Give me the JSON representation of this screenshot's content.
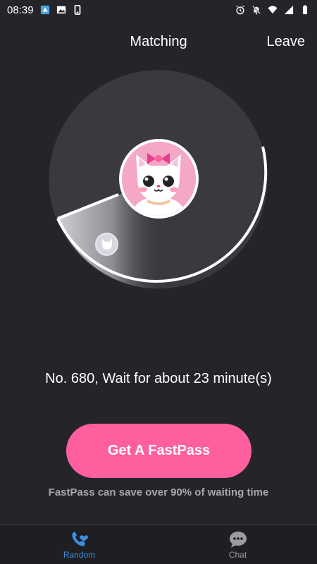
{
  "status_bar": {
    "time": "08:39",
    "left_icons": [
      "app-notification-icon",
      "image-icon",
      "phone-icon"
    ],
    "right_icons": [
      "alarm-icon",
      "bell-off-icon",
      "wifi-icon",
      "signal-icon",
      "battery-icon"
    ]
  },
  "header": {
    "title": "Matching",
    "leave_label": "Leave"
  },
  "queue": {
    "wait_text": "No. 680, Wait for about 23 minute(s)"
  },
  "fastpass": {
    "button_label": "Get A FastPass",
    "note": "FastPass can save over 90% of waiting time"
  },
  "bottom_nav": {
    "tabs": [
      {
        "label": "Random",
        "icon": "phone-heart-icon",
        "active": true
      },
      {
        "label": "Chat",
        "icon": "chat-bubble-icon",
        "active": false
      }
    ]
  },
  "colors": {
    "background": "#252428",
    "accent_pink": "#ff5f9e",
    "active_tab": "#3a8fe0",
    "inactive_tab": "#9b9ba2"
  }
}
